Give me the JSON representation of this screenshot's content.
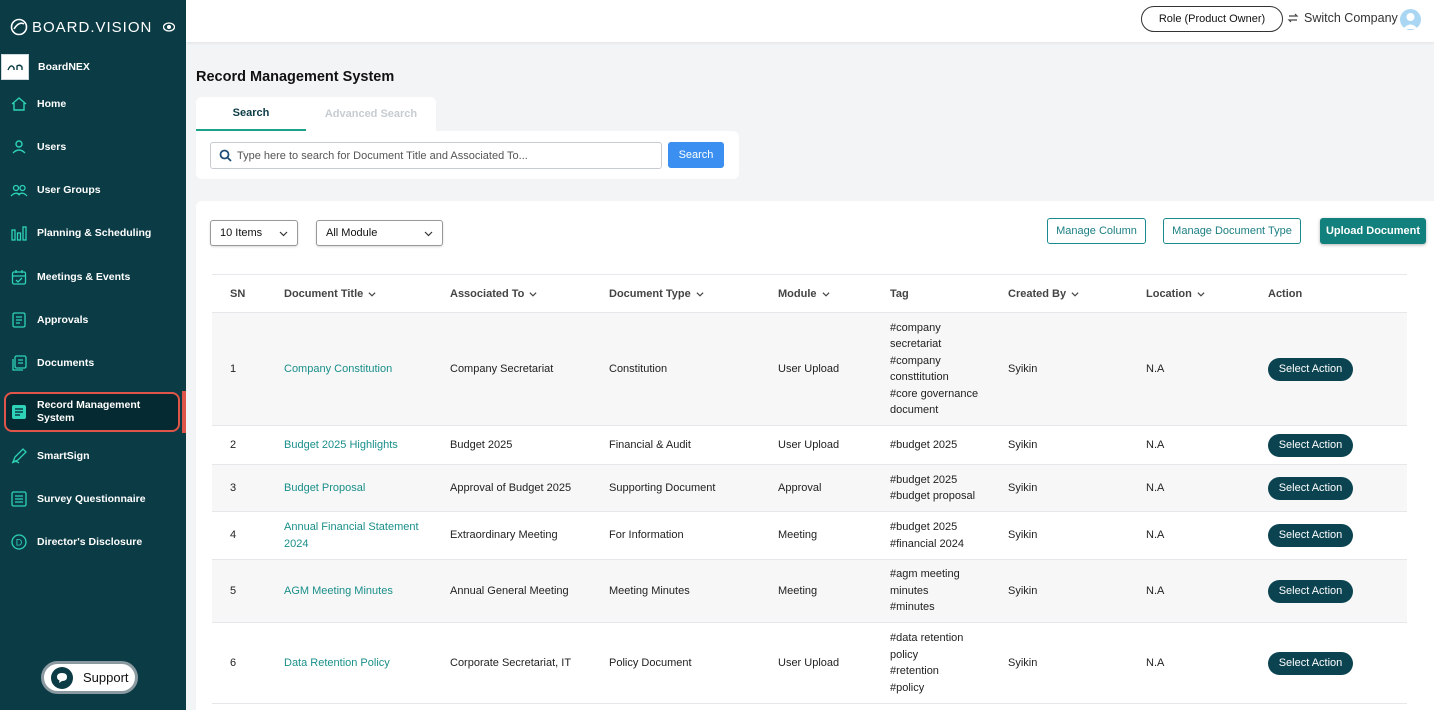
{
  "sidebar": {
    "logo": "BOARD.VISION",
    "org": {
      "badge": "BN",
      "name": "BoardNEX"
    },
    "items": [
      {
        "label": "Home",
        "icon": "home-icon"
      },
      {
        "label": "Users",
        "icon": "user-icon"
      },
      {
        "label": "User Groups",
        "icon": "user-groups-icon"
      },
      {
        "label": "Planning & Scheduling",
        "icon": "chart-bars-icon"
      },
      {
        "label": "Meetings & Events",
        "icon": "calendar-icon"
      },
      {
        "label": "Approvals",
        "icon": "approval-doc-icon"
      },
      {
        "label": "Documents",
        "icon": "documents-icon"
      },
      {
        "label": "Record Management System",
        "icon": "record-icon"
      },
      {
        "label": "SmartSign",
        "icon": "pen-icon"
      },
      {
        "label": "Survey Questionnaire",
        "icon": "survey-icon"
      },
      {
        "label": "Director's Disclosure",
        "icon": "disclosure-icon"
      }
    ],
    "support": "Support"
  },
  "topbar": {
    "role": "Role (Product Owner)",
    "switch_company": "Switch Company"
  },
  "page": {
    "title": "Record Management System",
    "tabs": [
      "Search",
      "Advanced Search"
    ]
  },
  "search": {
    "placeholder": "Type here to search for Document Title and Associated To...",
    "button": "Search"
  },
  "toolbar": {
    "items_select": "10 Items",
    "module_select": "All Module",
    "manage_column": "Manage Column",
    "manage_doc_type": "Manage Document Type",
    "upload": "Upload Document"
  },
  "table": {
    "columns": [
      "SN",
      "Document Title",
      "Associated To",
      "Document Type",
      "Module",
      "Tag",
      "Created By",
      "Location",
      "Action"
    ],
    "action_label": "Select Action",
    "rows": [
      {
        "sn": "1",
        "title": "Company Constitution",
        "associated": "Company Secretariat",
        "type": "Constitution",
        "module": "User Upload",
        "tag": [
          "#company",
          "secretariat",
          "#company",
          "consttitution",
          "#core governance",
          "document"
        ],
        "created_by": "Syikin",
        "location": "N.A"
      },
      {
        "sn": "2",
        "title": "Budget 2025 Highlights",
        "associated": "Budget 2025",
        "type": "Financial & Audit",
        "module": "User Upload",
        "tag": [
          "#budget 2025"
        ],
        "created_by": "Syikin",
        "location": "N.A"
      },
      {
        "sn": "3",
        "title": "Budget Proposal",
        "associated": "Approval of Budget 2025",
        "type": "Supporting Document",
        "module": "Approval",
        "tag": [
          "#budget 2025",
          "#budget proposal"
        ],
        "created_by": "Syikin",
        "location": "N.A"
      },
      {
        "sn": "4",
        "title": [
          "Annual Financial Statement",
          "2024"
        ],
        "associated": "Extraordinary Meeting",
        "type": "For Information",
        "module": "Meeting",
        "tag": [
          "#budget 2025",
          "#financial 2024"
        ],
        "created_by": "Syikin",
        "location": "N.A"
      },
      {
        "sn": "5",
        "title": "AGM Meeting Minutes",
        "associated": "Annual General Meeting",
        "type": "Meeting Minutes",
        "module": "Meeting",
        "tag": [
          "#agm meeting",
          "minutes",
          "#minutes"
        ],
        "created_by": "Syikin",
        "location": "N.A"
      },
      {
        "sn": "6",
        "title": "Data Retention Policy",
        "associated": "Corporate Secretariat, IT",
        "type": "Policy Document",
        "module": "User Upload",
        "tag": [
          "#data retention",
          "policy",
          "#retention",
          "#policy"
        ],
        "created_by": "Syikin",
        "location": "N.A"
      }
    ]
  },
  "colors": {
    "sidebar_bg": "#0b3b45",
    "accent": "#12807d",
    "link": "#1a8f8a",
    "active_outline": "#e0554a",
    "search_button": "#3b8ff0"
  }
}
